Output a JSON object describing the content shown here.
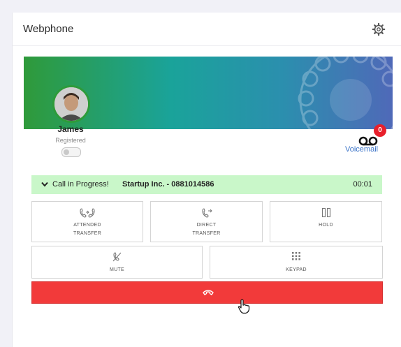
{
  "header": {
    "title": "Webphone",
    "settings_icon": "gear-icon"
  },
  "user": {
    "name": "James",
    "status": "Registered"
  },
  "voicemail": {
    "label": "Voicemail",
    "count": "0",
    "icon": "voicemail-icon"
  },
  "call": {
    "status": "Call in Progress!",
    "party": "Startup Inc. - 0881014586",
    "timer": "00:01"
  },
  "actions": {
    "attended_transfer": {
      "line1": "ATTENDED",
      "line2": "TRANSFER"
    },
    "direct_transfer": {
      "line1": "DIRECT",
      "line2": "TRANSFER"
    },
    "hold": "HOLD",
    "mute": "MUTE",
    "keypad": "KEYPAD"
  },
  "colors": {
    "hangup": "#f23a3a",
    "call_bar": "#c9f7c9",
    "badge": "#e8202c",
    "link": "#3a73c8"
  }
}
